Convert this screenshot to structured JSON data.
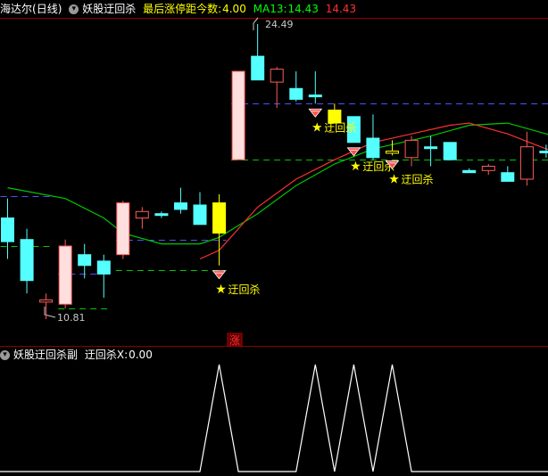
{
  "main_panel": {
    "stock_name": "海达尔",
    "period": "(日线)",
    "indicator_name": "妖股迂回杀",
    "stat_label": "最后涨停距今数:",
    "stat_value": "4.00",
    "ma_label": "MA13:",
    "ma_value": "14.43",
    "extra_value": "14.43",
    "colors": {
      "up": "#ff5a5a",
      "down": "#54ffff",
      "limit_fill": "#ffdede",
      "flat_yellow": "#ffff00",
      "ma": "#00c800",
      "trend": "#ff3030",
      "blue_dash": "#5050ff",
      "green_dash": "#00c800"
    }
  },
  "sub_panel": {
    "indicator_name": "妖股迂回杀副",
    "series_label": "迂回杀X:",
    "series_value": "0.00"
  },
  "annotations": {
    "signal_text": "迂回杀",
    "limit_marker": "涨"
  },
  "chart_data": [
    {
      "type": "candlestick",
      "price_max_label": "24.49",
      "price_min_label": "10.81",
      "candles": [
        {
          "o": 15.5,
          "h": 16.4,
          "l": 13.6,
          "c": 14.4
        },
        {
          "o": 14.5,
          "h": 15.0,
          "l": 12.0,
          "c": 12.6
        },
        {
          "o": 11.6,
          "h": 12.0,
          "l": 10.81,
          "c": 11.7
        },
        {
          "o": 11.5,
          "h": 14.5,
          "l": 11.3,
          "c": 14.2
        },
        {
          "o": 13.8,
          "h": 14.3,
          "l": 12.7,
          "c": 13.3
        },
        {
          "o": 13.5,
          "h": 13.8,
          "l": 11.8,
          "c": 12.9
        },
        {
          "o": 13.8,
          "h": 16.3,
          "l": 13.6,
          "c": 16.2
        },
        {
          "o": 15.5,
          "h": 16.0,
          "l": 15.0,
          "c": 15.8
        },
        {
          "o": 15.7,
          "h": 15.8,
          "l": 15.5,
          "c": 15.7
        },
        {
          "o": 16.2,
          "h": 16.9,
          "l": 15.7,
          "c": 15.9
        },
        {
          "o": 16.1,
          "h": 16.7,
          "l": 15.2,
          "c": 15.2
        },
        {
          "o": 14.8,
          "h": 16.6,
          "l": 13.3,
          "c": 16.2
        },
        {
          "o": 18.2,
          "h": 22.3,
          "l": 18.2,
          "c": 22.3
        },
        {
          "o": 23.0,
          "h": 24.49,
          "l": 21.9,
          "c": 21.9
        },
        {
          "o": 21.8,
          "h": 22.5,
          "l": 20.6,
          "c": 22.4
        },
        {
          "o": 21.5,
          "h": 22.3,
          "l": 20.9,
          "c": 21.0
        },
        {
          "o": 21.2,
          "h": 22.3,
          "l": 20.8,
          "c": 21.2
        },
        {
          "o": 20.5,
          "h": 20.8,
          "l": 19.9,
          "c": 19.9
        },
        {
          "o": 20.2,
          "h": 20.2,
          "l": 19.0,
          "c": 19.0
        },
        {
          "o": 19.2,
          "h": 20.3,
          "l": 18.2,
          "c": 18.3
        },
        {
          "o": 18.5,
          "h": 19.1,
          "l": 18.4,
          "c": 18.6
        },
        {
          "o": 18.3,
          "h": 19.3,
          "l": 17.9,
          "c": 19.1
        },
        {
          "o": 18.8,
          "h": 19.3,
          "l": 17.9,
          "c": 18.8
        },
        {
          "o": 19.0,
          "h": 19.0,
          "l": 18.2,
          "c": 18.2
        },
        {
          "o": 17.7,
          "h": 17.8,
          "l": 17.6,
          "c": 17.6
        },
        {
          "o": 17.7,
          "h": 18.0,
          "l": 17.5,
          "c": 17.9
        },
        {
          "o": 17.6,
          "h": 17.9,
          "l": 17.2,
          "c": 17.2
        },
        {
          "o": 17.3,
          "h": 19.5,
          "l": 17.0,
          "c": 18.8
        },
        {
          "o": 18.6,
          "h": 18.9,
          "l": 18.3,
          "c": 18.6
        },
        {
          "o": 18.4,
          "h": 18.6,
          "l": 18.0,
          "c": 18.2
        },
        {
          "o": 18.1,
          "h": 18.5,
          "l": 17.9,
          "c": 18.3
        }
      ],
      "ma13": [
        {
          "i": 0,
          "v": 16.9
        },
        {
          "i": 3,
          "v": 16.4
        },
        {
          "i": 5,
          "v": 15.5
        },
        {
          "i": 6,
          "v": 14.8
        },
        {
          "i": 8,
          "v": 14.3
        },
        {
          "i": 10,
          "v": 14.3
        },
        {
          "i": 11,
          "v": 14.6
        },
        {
          "i": 13,
          "v": 15.7
        },
        {
          "i": 15,
          "v": 17.0
        },
        {
          "i": 17,
          "v": 18.0
        },
        {
          "i": 19,
          "v": 18.7
        },
        {
          "i": 22,
          "v": 19.3
        },
        {
          "i": 24,
          "v": 19.8
        },
        {
          "i": 26,
          "v": 19.9
        },
        {
          "i": 28,
          "v": 19.4
        },
        {
          "i": 30,
          "v": 18.9
        }
      ],
      "trend": [
        {
          "i": 10,
          "v": 13.6
        },
        {
          "i": 11,
          "v": 14.0
        },
        {
          "i": 12,
          "v": 15.0
        },
        {
          "i": 13,
          "v": 16.0
        },
        {
          "i": 15,
          "v": 17.3
        },
        {
          "i": 17,
          "v": 18.2
        },
        {
          "i": 19,
          "v": 19.0
        },
        {
          "i": 21,
          "v": 19.4
        },
        {
          "i": 23,
          "v": 19.8
        },
        {
          "i": 24,
          "v": 19.9
        },
        {
          "i": 26,
          "v": 19.4
        },
        {
          "i": 28,
          "v": 18.7
        },
        {
          "i": 30,
          "v": 18.4
        }
      ],
      "levels": [
        {
          "color": "blue",
          "from": 0,
          "to": 2,
          "v": 16.5
        },
        {
          "color": "green",
          "from": 0,
          "to": 2,
          "v": 14.2
        },
        {
          "color": "blue",
          "from": 3,
          "to": 5,
          "v": 12.9
        },
        {
          "color": "green",
          "from": 3,
          "to": 5,
          "v": 11.3
        },
        {
          "color": "blue",
          "from": 6,
          "to": 11,
          "v": 14.5
        },
        {
          "color": "green",
          "from": 6,
          "to": 11,
          "v": 13.1
        },
        {
          "color": "blue",
          "from": 12,
          "to": 30,
          "v": 20.8
        },
        {
          "color": "green",
          "from": 12,
          "to": 30,
          "v": 18.2
        }
      ],
      "signals": [
        11,
        16,
        18,
        20
      ]
    },
    {
      "type": "line",
      "ylim": [
        0,
        1
      ],
      "values": [
        0,
        0,
        0,
        0,
        0,
        0,
        0,
        0,
        0,
        0,
        0,
        1,
        0,
        0,
        0,
        0,
        1,
        0,
        1,
        0,
        1,
        0,
        0,
        0,
        0,
        0,
        0,
        0,
        0,
        0,
        0
      ]
    }
  ]
}
